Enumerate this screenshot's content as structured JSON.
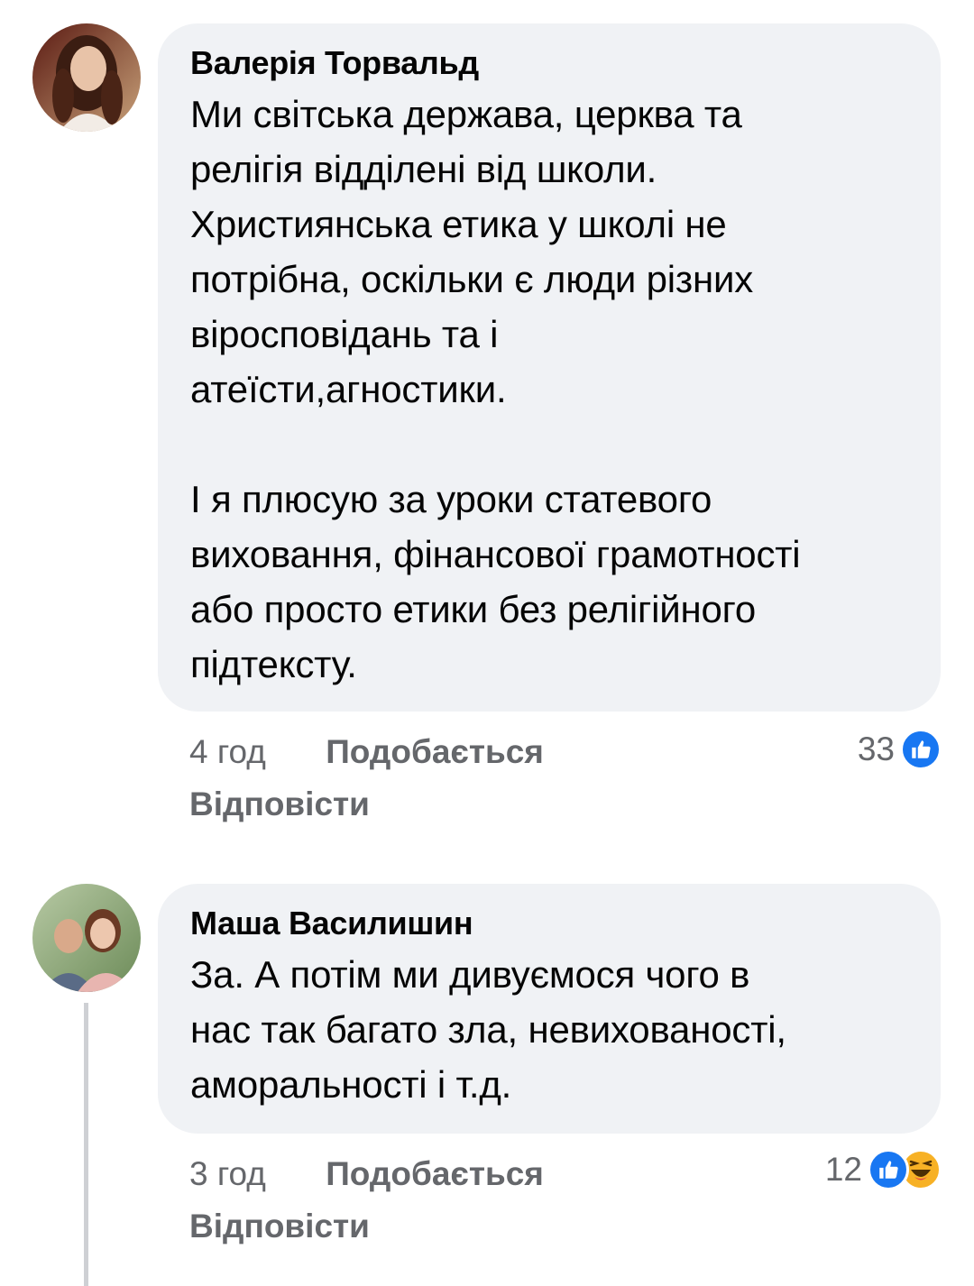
{
  "comments": [
    {
      "author": "Валерія Торвальд",
      "text": "Ми світська держава, церква та\nрелігія відділені від школи.\nХристиянська етика у школі не\nпотрібна, оскільки є люди різних\nвіросповідань та і\nатеїсти,агностики.\n\nІ я плюсую за уроки статевого\nвиховання, фінансової грамотності\nабо просто етики без релігійного\nпідтексту.",
      "time": "4 год",
      "like_label": "Подобається",
      "reply_label": "Відповісти",
      "reaction_count": "33",
      "reactions": [
        "like-icon"
      ]
    },
    {
      "author": "Маша Василишин",
      "text": "За. А потім ми дивуємося чого в\nнас так багато зла, невихованості,\nаморальності і т.д.",
      "time": "3 год",
      "like_label": "Подобається",
      "reply_label": "Відповісти",
      "reaction_count": "12",
      "reactions": [
        "like-icon",
        "haha-icon"
      ]
    }
  ],
  "colors": {
    "bubble": "#f0f2f5",
    "meta_text": "#65676b",
    "like_blue": "#1877f2",
    "haha_yellow": "#f7b125",
    "thread_line": "#ced0d4"
  }
}
